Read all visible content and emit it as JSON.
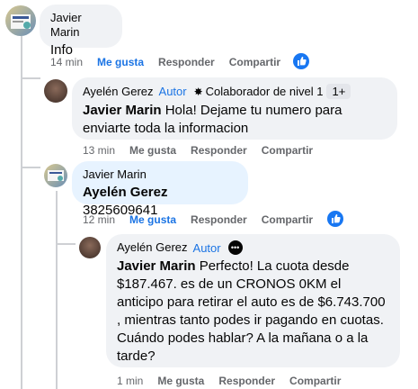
{
  "comments": [
    {
      "author": "Javier Marin",
      "text": "Info",
      "time": "14 min",
      "like": "Me gusta",
      "reply": "Responder",
      "share": "Compartir"
    },
    {
      "author": "Ayelén Gerez",
      "role": "Autor",
      "badge": "Colaborador de nivel 1",
      "badge_extra": "1+",
      "mention": "Javier Marin",
      "text": " Hola! Dejame tu numero para enviarte toda la informacion",
      "time": "13 min",
      "like": "Me gusta",
      "reply": "Responder",
      "share": "Compartir"
    },
    {
      "author": "Javier Marin",
      "mention": "Ayelén Gerez",
      "text": " 3825609641",
      "time": "12 min",
      "like": "Me gusta",
      "reply": "Responder",
      "share": "Compartir"
    },
    {
      "author": "Ayelén Gerez",
      "role": "Autor",
      "mention": "Javier Marin",
      "text": " Perfecto! La cuota desde $187.467. es de un CRONOS 0KM el anticipo para retirar el auto es de $6.743.700 , mientras tanto podes ir pagando en cuotas. Cuándo podes hablar? A la mañana o a la tarde?",
      "time": "1 min",
      "like": "Me gusta",
      "reply": "Responder",
      "share": "Compartir"
    }
  ],
  "colors": {
    "accent": "#1877f2",
    "bubble": "#f0f2f5",
    "bubble_highlight": "#e7f3ff"
  }
}
